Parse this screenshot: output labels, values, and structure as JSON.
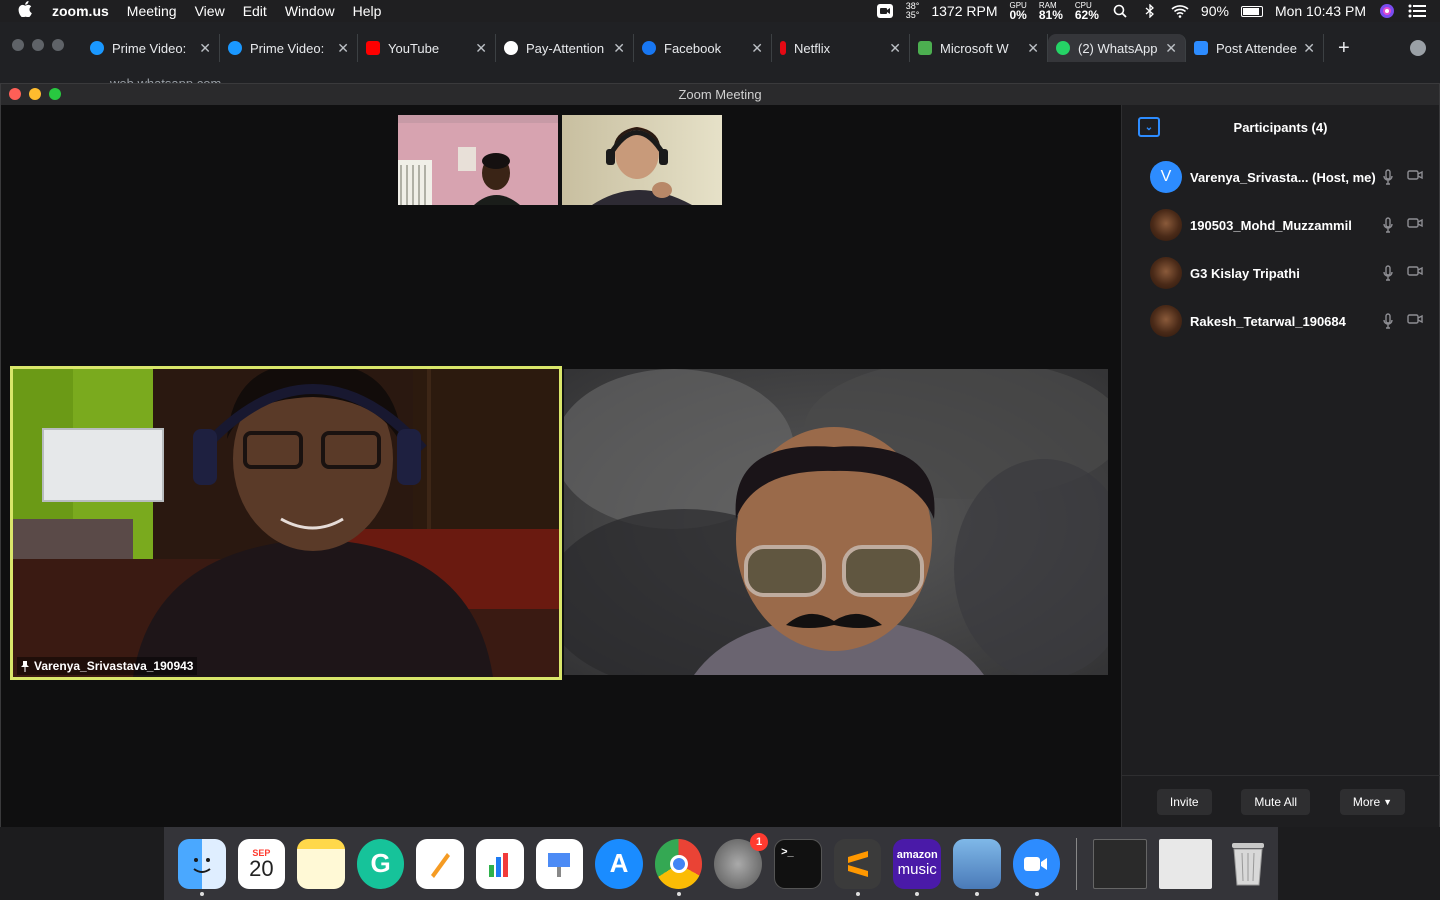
{
  "menubar": {
    "app": "zoom.us",
    "items": [
      "Meeting",
      "View",
      "Edit",
      "Window",
      "Help"
    ],
    "temps": "38°\n35°",
    "rpm": "1372 RPM",
    "gpu_label": "GPU",
    "gpu_value": "0%",
    "ram_label": "RAM",
    "ram_value": "81%",
    "cpu_label": "CPU",
    "cpu_value": "62%",
    "battery_pct": "90%",
    "battery_fill": 0.9,
    "clock": "Mon 10:43 PM"
  },
  "browser": {
    "tabs": [
      {
        "label": "Prime Video:",
        "color": "#1a98ff"
      },
      {
        "label": "Prime Video:",
        "color": "#1a98ff"
      },
      {
        "label": "YouTube",
        "color": "#ff0000"
      },
      {
        "label": "Pay-Attention",
        "color": "#ffffff"
      },
      {
        "label": "Facebook",
        "color": "#1877f2"
      },
      {
        "label": "Netflix",
        "color": "#e50914"
      },
      {
        "label": "Microsoft W",
        "color": "#4caf50"
      },
      {
        "label": "(2) WhatsApp",
        "color": "#25d366"
      },
      {
        "label": "Post Attendee",
        "color": "#2d8cff"
      }
    ],
    "url": "web.whatsapp.com"
  },
  "zoom": {
    "title": "Zoom Meeting",
    "main_speaker_label": "Varenya_Srivastava_190943",
    "accent": "#d9e66a"
  },
  "participants": {
    "header": "Participants (4)",
    "list": [
      {
        "name": "Varenya_Srivasta...",
        "tag": " (Host, me)",
        "avatar_letter": "V",
        "type": "letter"
      },
      {
        "name": "190503_Mohd_Muzzammil",
        "tag": "",
        "avatar_letter": "",
        "type": "img"
      },
      {
        "name": "G3 Kislay Tripathi",
        "tag": "",
        "avatar_letter": "",
        "type": "img"
      },
      {
        "name": "Rakesh_Tetarwal_190684",
        "tag": "",
        "avatar_letter": "",
        "type": "img"
      }
    ],
    "invite": "Invite",
    "mute_all": "Mute All",
    "more": "More"
  },
  "dock": {
    "calendar_month": "SEP",
    "calendar_day": "20",
    "settings_badge": "1",
    "amazon_music_top": "amazon",
    "amazon_music_bottom": "music"
  }
}
